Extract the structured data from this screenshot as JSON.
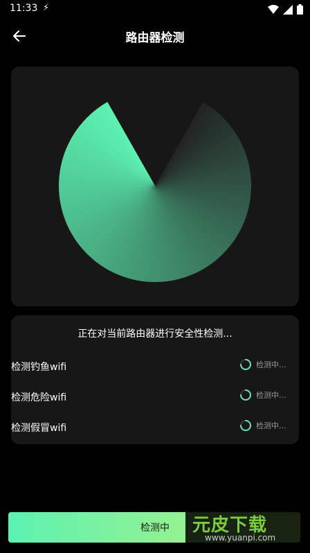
{
  "status_bar": {
    "time": "11:33"
  },
  "header": {
    "title": "路由器检测"
  },
  "check": {
    "title": "正在对当前路由器进行安全性检测...",
    "items": [
      {
        "label": "检测钓鱼wifi",
        "status": "检测中..."
      },
      {
        "label": "检测危险wifi",
        "status": "检测中..."
      },
      {
        "label": "检测假冒wifi",
        "status": "检测中..."
      }
    ]
  },
  "button": {
    "label": "检测中"
  },
  "watermark": {
    "title": "元皮下载",
    "url": "www.yuanpi.com"
  },
  "colors": {
    "accent": "#5cf2b2",
    "accent_end": "#b8f37a",
    "card": "#171717",
    "background": "#000000"
  }
}
